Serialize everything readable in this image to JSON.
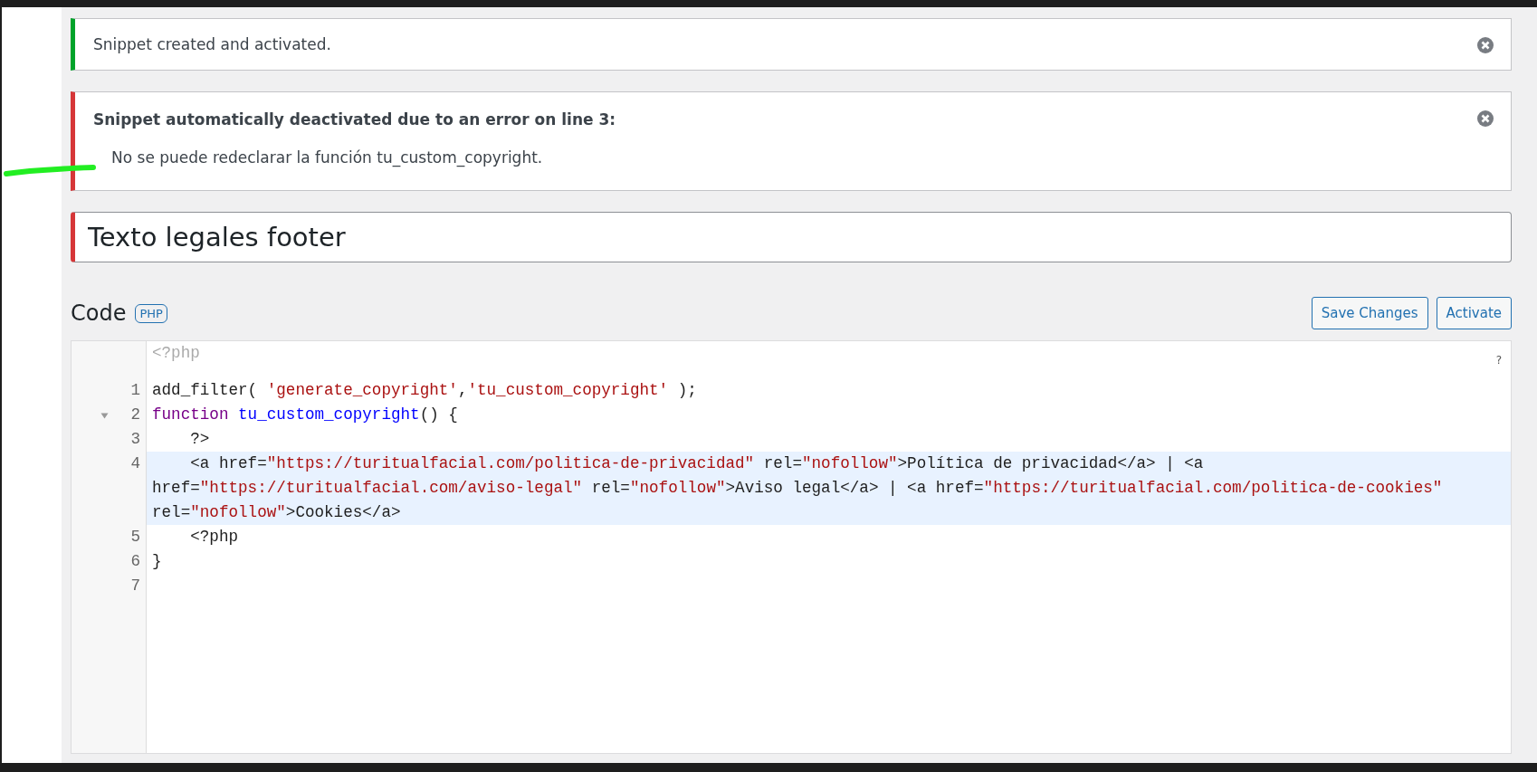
{
  "notices": [
    {
      "kind": "success",
      "title": "Snippet created and activated."
    },
    {
      "kind": "error",
      "title": "Snippet automatically deactivated due to an error on line 3:",
      "message": "No se puede redeclarar la función tu_custom_copyright."
    }
  ],
  "title_field": {
    "value": "Texto legales footer"
  },
  "code_section": {
    "heading": "Code",
    "badge": "PHP",
    "buttons": [
      "Save Changes",
      "Activate"
    ]
  },
  "editor": {
    "header": "<?php",
    "help": "?",
    "lines": [
      {
        "number": "1",
        "active": false,
        "foldable": false,
        "tokens": [
          {
            "kind": "plain",
            "text": "add_filter( "
          },
          {
            "kind": "string",
            "text": "'generate_copyright'"
          },
          {
            "kind": "plain",
            "text": ","
          },
          {
            "kind": "string",
            "text": "'tu_custom_copyright'"
          },
          {
            "kind": "plain",
            "text": " );"
          }
        ]
      },
      {
        "number": "2",
        "active": false,
        "foldable": true,
        "tokens": [
          {
            "kind": "keyword",
            "text": "function "
          },
          {
            "kind": "def",
            "text": "tu_custom_copyright"
          },
          {
            "kind": "plain",
            "text": "() {"
          }
        ]
      },
      {
        "number": "3",
        "active": false,
        "foldable": false,
        "tokens": [
          {
            "kind": "plain",
            "text": "    ?>"
          }
        ]
      },
      {
        "number": "4",
        "active": true,
        "foldable": false,
        "tokens": [
          {
            "kind": "plain",
            "text": "    <a href="
          },
          {
            "kind": "string",
            "text": "\"https://turitualfacial.com/politica-de-privacidad\""
          },
          {
            "kind": "plain",
            "text": " rel="
          },
          {
            "kind": "string",
            "text": "\"nofollow\""
          },
          {
            "kind": "plain",
            "text": ">Política de privacidad</a> | <a href="
          },
          {
            "kind": "string",
            "text": "\"https://turitualfacial.com/aviso-legal\""
          },
          {
            "kind": "plain",
            "text": " rel="
          },
          {
            "kind": "string",
            "text": "\"nofollow\""
          },
          {
            "kind": "plain",
            "text": ">Aviso legal</a> | <a href="
          },
          {
            "kind": "string",
            "text": "\"https://turitualfacial.com/politica-de-cookies\""
          },
          {
            "kind": "plain",
            "text": " rel="
          },
          {
            "kind": "string",
            "text": "\"nofollow\""
          },
          {
            "kind": "plain",
            "text": ">Cookies</a>"
          }
        ]
      },
      {
        "number": "5",
        "active": false,
        "foldable": false,
        "tokens": [
          {
            "kind": "plain",
            "text": "    <?php"
          }
        ]
      },
      {
        "number": "6",
        "active": false,
        "foldable": false,
        "tokens": [
          {
            "kind": "plain",
            "text": "}"
          }
        ]
      },
      {
        "number": "7",
        "active": false,
        "foldable": false
      }
    ]
  }
}
